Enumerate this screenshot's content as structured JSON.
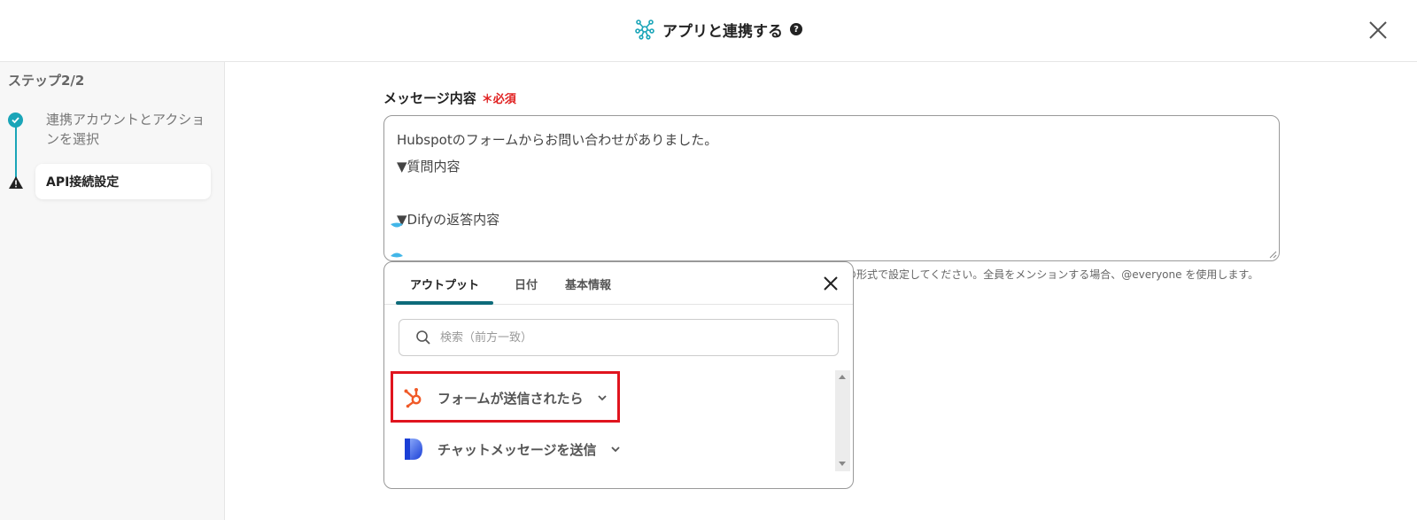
{
  "header": {
    "title": "アプリと連携する",
    "help_glyph": "?",
    "icons": {
      "app": "network-hub-icon",
      "help": "question-circle-icon",
      "close": "close-icon"
    }
  },
  "sidebar": {
    "step_title": "ステップ2/2",
    "steps": [
      {
        "label": "連携アカウントとアクションを選択",
        "status": "done"
      },
      {
        "label": "API接続設定",
        "status": "warning"
      }
    ]
  },
  "field": {
    "label": "メッセージ内容",
    "required_mark": "＊必須",
    "lines": [
      "Hubspotのフォームからお問い合わせがありました。",
      "▼質問内容",
      "",
      "▼Difyの返答内容",
      ""
    ],
    "hint": "の形式で設定してください。全員をメンションする場合、@everyone を使用します。"
  },
  "popup": {
    "tabs": [
      {
        "label": "アウトプット",
        "active": true
      },
      {
        "label": "日付",
        "active": false
      },
      {
        "label": "基本情報",
        "active": false
      }
    ],
    "search_placeholder": "検索（前方一致）",
    "items": [
      {
        "label": "フォームが送信されたら",
        "icon": "hubspot-logo-icon",
        "highlighted": true
      },
      {
        "label": "チャットメッセージを送信",
        "icon": "dify-logo-icon",
        "highlighted": false
      }
    ]
  },
  "colors": {
    "accent": "#1aa5b8",
    "tab_underline": "#0e6b7a",
    "required": "#e02020",
    "highlight": "#e0141e",
    "hubspot": "#f05a28",
    "dify": "#1a3fd6"
  }
}
